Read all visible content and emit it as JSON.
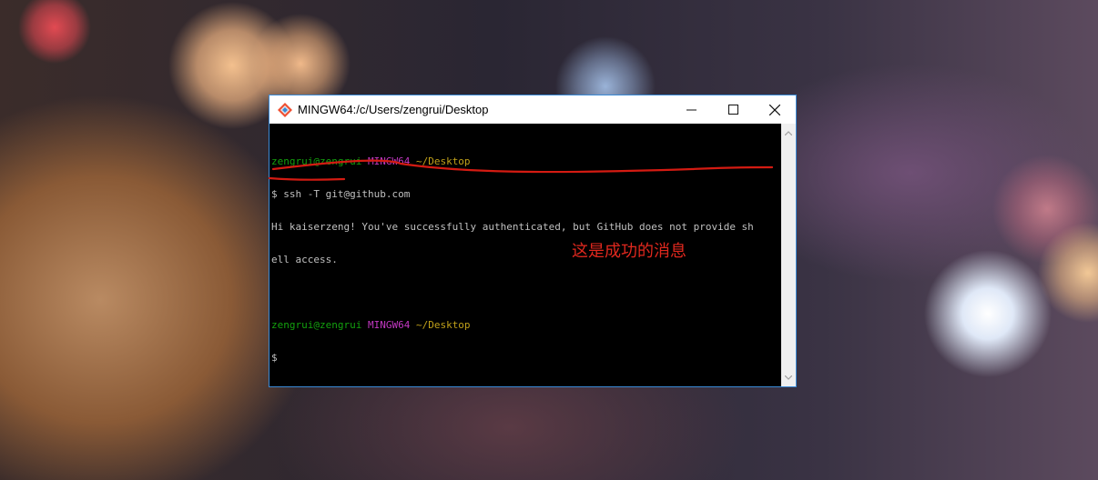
{
  "window": {
    "title": "MINGW64:/c/Users/zengrui/Desktop",
    "border_color": "#3a8ad6"
  },
  "terminal": {
    "lines": [
      {
        "user": "zengrui@zengrui",
        "shell": "MINGW64",
        "path": "~/Desktop"
      },
      {
        "text": "$ ssh -T git@github.com"
      },
      {
        "text": "Hi kaiserzeng! You've successfully authenticated, but GitHub does not provide sh"
      },
      {
        "text": "ell access."
      },
      {
        "text": ""
      },
      {
        "user": "zengrui@zengrui",
        "shell": "MINGW64",
        "path": "~/Desktop"
      },
      {
        "text": "$"
      }
    ]
  },
  "annotation": {
    "text": "这是成功的消息",
    "color": "#e0281e"
  },
  "icons": [
    "git-bash-icon",
    "minimize-icon",
    "maximize-icon",
    "close-icon",
    "scroll-up-icon",
    "scroll-down-icon"
  ]
}
